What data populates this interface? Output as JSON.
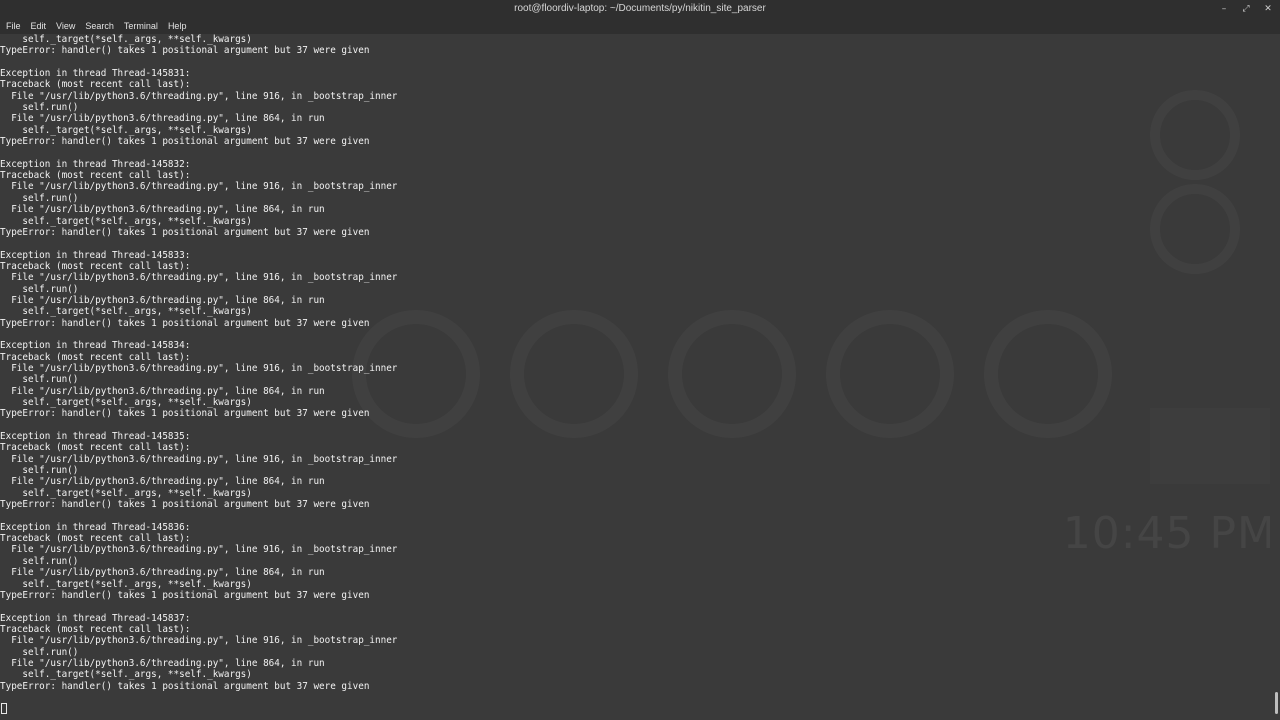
{
  "window": {
    "title": "root@floordiv-laptop: ~/Documents/py/nikitin_site_parser",
    "controls": [
      "–",
      "⤢",
      "✕"
    ]
  },
  "menu": [
    "File",
    "Edit",
    "View",
    "Search",
    "Terminal",
    "Help"
  ],
  "desktop_background": {
    "clock_text": "10:45 PM"
  },
  "terminal": {
    "lines": [
      "    self._target(*self._args, **self._kwargs)",
      "TypeError: handler() takes 1 positional argument but 37 were given",
      "",
      "Exception in thread Thread-145831:",
      "Traceback (most recent call last):",
      "  File \"/usr/lib/python3.6/threading.py\", line 916, in _bootstrap_inner",
      "    self.run()",
      "  File \"/usr/lib/python3.6/threading.py\", line 864, in run",
      "    self._target(*self._args, **self._kwargs)",
      "TypeError: handler() takes 1 positional argument but 37 were given",
      "",
      "Exception in thread Thread-145832:",
      "Traceback (most recent call last):",
      "  File \"/usr/lib/python3.6/threading.py\", line 916, in _bootstrap_inner",
      "    self.run()",
      "  File \"/usr/lib/python3.6/threading.py\", line 864, in run",
      "    self._target(*self._args, **self._kwargs)",
      "TypeError: handler() takes 1 positional argument but 37 were given",
      "",
      "Exception in thread Thread-145833:",
      "Traceback (most recent call last):",
      "  File \"/usr/lib/python3.6/threading.py\", line 916, in _bootstrap_inner",
      "    self.run()",
      "  File \"/usr/lib/python3.6/threading.py\", line 864, in run",
      "    self._target(*self._args, **self._kwargs)",
      "TypeError: handler() takes 1 positional argument but 37 were given",
      "",
      "Exception in thread Thread-145834:",
      "Traceback (most recent call last):",
      "  File \"/usr/lib/python3.6/threading.py\", line 916, in _bootstrap_inner",
      "    self.run()",
      "  File \"/usr/lib/python3.6/threading.py\", line 864, in run",
      "    self._target(*self._args, **self._kwargs)",
      "TypeError: handler() takes 1 positional argument but 37 were given",
      "",
      "Exception in thread Thread-145835:",
      "Traceback (most recent call last):",
      "  File \"/usr/lib/python3.6/threading.py\", line 916, in _bootstrap_inner",
      "    self.run()",
      "  File \"/usr/lib/python3.6/threading.py\", line 864, in run",
      "    self._target(*self._args, **self._kwargs)",
      "TypeError: handler() takes 1 positional argument but 37 were given",
      "",
      "Exception in thread Thread-145836:",
      "Traceback (most recent call last):",
      "  File \"/usr/lib/python3.6/threading.py\", line 916, in _bootstrap_inner",
      "    self.run()",
      "  File \"/usr/lib/python3.6/threading.py\", line 864, in run",
      "    self._target(*self._args, **self._kwargs)",
      "TypeError: handler() takes 1 positional argument but 37 were given",
      "",
      "Exception in thread Thread-145837:",
      "Traceback (most recent call last):",
      "  File \"/usr/lib/python3.6/threading.py\", line 916, in _bootstrap_inner",
      "    self.run()",
      "  File \"/usr/lib/python3.6/threading.py\", line 864, in run",
      "    self._target(*self._args, **self._kwargs)",
      "TypeError: handler() takes 1 positional argument but 37 were given",
      ""
    ]
  }
}
